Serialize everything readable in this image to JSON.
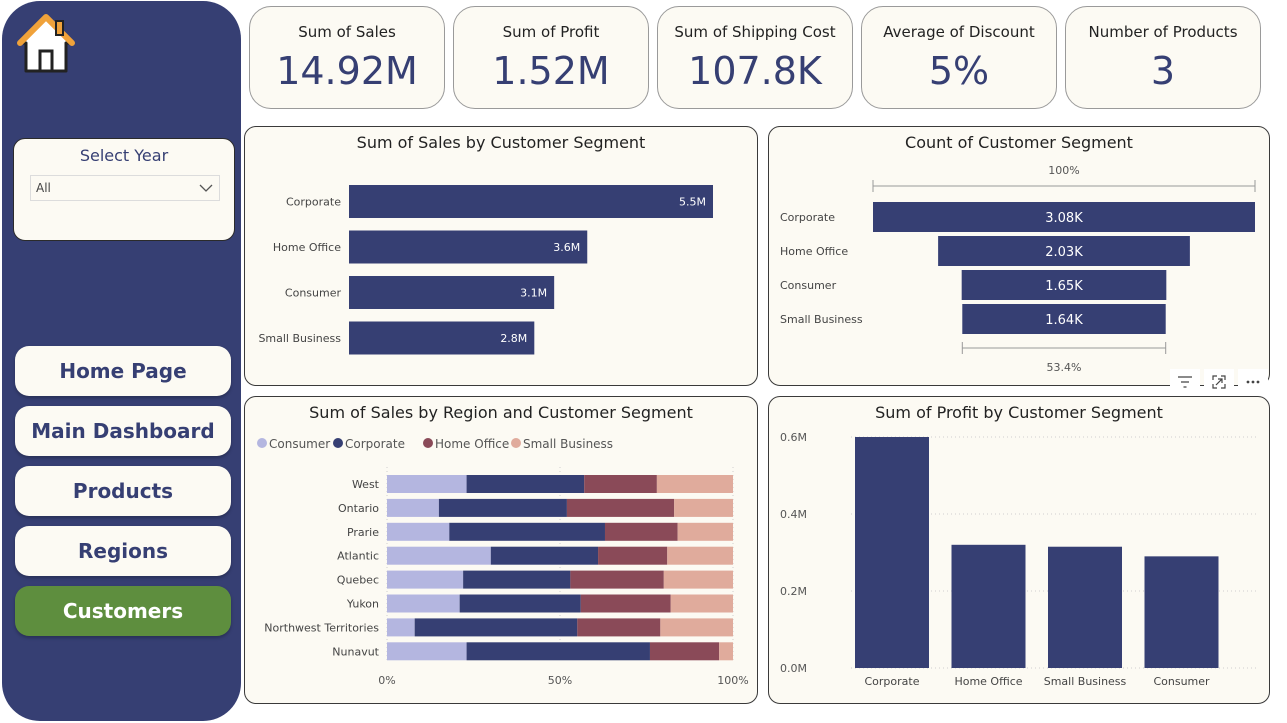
{
  "kpis": [
    {
      "label": "Sum of Sales",
      "value": "14.92M"
    },
    {
      "label": "Sum of Profit",
      "value": "1.52M"
    },
    {
      "label": "Sum of Shipping Cost",
      "value": "107.8K"
    },
    {
      "label": "Average of Discount",
      "value": "5%"
    },
    {
      "label": "Number of Products",
      "value": "3"
    }
  ],
  "filter": {
    "title": "Select Year",
    "value": "All"
  },
  "nav": {
    "home": "Home Page",
    "main": "Main Dashboard",
    "products": "Products",
    "regions": "Regions",
    "customers": "Customers"
  },
  "colors": {
    "navy": "#363f73",
    "active": "#5e8e3e",
    "consumer": "#b4b6e0",
    "corporate": "#363f73",
    "home_office": "#8a4a58",
    "small_business": "#e0ab9c"
  },
  "chart_data": [
    {
      "type": "bar",
      "orientation": "horizontal",
      "title": "Sum of Sales by Customer Segment",
      "categories": [
        "Corporate",
        "Home Office",
        "Consumer",
        "Small Business"
      ],
      "values": [
        5.5,
        3.6,
        3.1,
        2.8
      ],
      "data_labels": [
        "5.5M",
        "3.6M",
        "3.1M",
        "2.8M"
      ],
      "unit": "M"
    },
    {
      "type": "funnel",
      "title": "Count of Customer Segment",
      "categories": [
        "Corporate",
        "Home Office",
        "Consumer",
        "Small Business"
      ],
      "values": [
        3080,
        2030,
        1650,
        1640
      ],
      "data_labels": [
        "3.08K",
        "2.03K",
        "1.65K",
        "1.64K"
      ],
      "top_percent": "100%",
      "bottom_percent": "53.4%"
    },
    {
      "type": "bar",
      "stacked": "100%",
      "orientation": "horizontal",
      "title": "Sum of Sales by Region and Customer Segment",
      "legend_position": "top-left",
      "categories": [
        "West",
        "Ontario",
        "Prarie",
        "Atlantic",
        "Quebec",
        "Yukon",
        "Northwest Territories",
        "Nunavut"
      ],
      "series": [
        {
          "name": "Consumer",
          "values": [
            23,
            15,
            18,
            30,
            22,
            21,
            8,
            23
          ]
        },
        {
          "name": "Corporate",
          "values": [
            34,
            37,
            45,
            31,
            31,
            35,
            47,
            53
          ]
        },
        {
          "name": "Home Office",
          "values": [
            21,
            31,
            21,
            20,
            27,
            26,
            24,
            20
          ]
        },
        {
          "name": "Small Business",
          "values": [
            22,
            17,
            16,
            19,
            20,
            18,
            21,
            4
          ]
        }
      ],
      "x_ticks": [
        "0%",
        "50%",
        "100%"
      ],
      "xlim": [
        0,
        100
      ]
    },
    {
      "type": "bar",
      "orientation": "vertical",
      "title": "Sum of Profit by Customer Segment",
      "categories": [
        "Corporate",
        "Home Office",
        "Small Business",
        "Consumer"
      ],
      "values": [
        0.6,
        0.32,
        0.315,
        0.29
      ],
      "y_ticks": [
        "0.0M",
        "0.2M",
        "0.4M",
        "0.6M"
      ],
      "ylim": [
        0,
        0.6
      ],
      "grid": true
    }
  ]
}
